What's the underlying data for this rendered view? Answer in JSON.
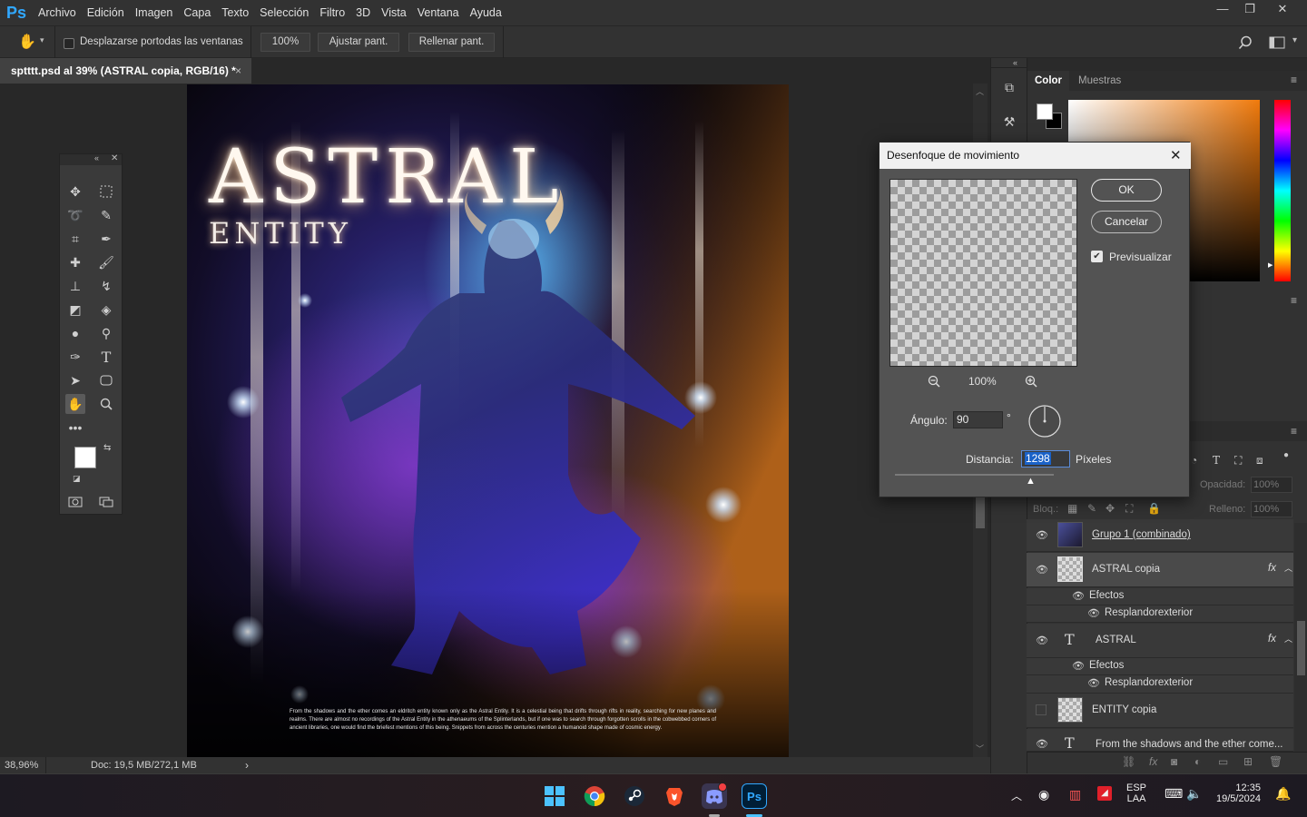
{
  "app": {
    "logo": "Ps",
    "menu": [
      "Archivo",
      "Edición",
      "Imagen",
      "Capa",
      "Texto",
      "Selección",
      "Filtro",
      "3D",
      "Vista",
      "Ventana",
      "Ayuda"
    ],
    "window_controls": {
      "minimize": "—",
      "restore": "❐",
      "close": "✕"
    }
  },
  "options": {
    "scroll_all_label": "Desplazarse portodas las ventanas",
    "zoom_100": "100%",
    "fit_screen": "Ajustar pant.",
    "fill_screen": "Rellenar pant."
  },
  "document": {
    "tab_title": "sptttt.psd al 39% (ASTRAL copia, RGB/16) *",
    "close": "×"
  },
  "artwork": {
    "title": "ASTRAL",
    "subtitle": "ENTITY",
    "body_text": "From the shadows and the ether comes an eldritch entity known only as the Astral Entity. It is a celestial being that drifts through rifts in reality, searching for new planes and realms. There are almost no recordings of the Astral Entity in the athenaeums of the Splinterlands, but if one was to search through forgotten scrolls in the cobwebbed corners of ancient libraries, one would find the briefest mentions of this being. Snippets from across the centuries mention a humanoid shape made of cosmic energy."
  },
  "status": {
    "zoom": "38,96%",
    "doc": "Doc: 19,5 MB/272,1 MB"
  },
  "color_panel": {
    "tabs": [
      "Color",
      "Muestras"
    ]
  },
  "dialog": {
    "title": "Desenfoque de movimiento",
    "ok": "OK",
    "cancel": "Cancelar",
    "preview_label": "Previsualizar",
    "preview_zoom": "100%",
    "angle_label": "Ángulo:",
    "angle_value": "90",
    "angle_unit": "°",
    "distance_label": "Distancia:",
    "distance_value": "1298",
    "distance_unit": "Píxeles"
  },
  "layers": {
    "lock_label": "Bloq.:",
    "opacity_label": "Opacidad:",
    "opacity_value": "100%",
    "fill_label": "Relleno:",
    "fill_value": "100%",
    "items": [
      {
        "name": "Grupo 1 (combinado)",
        "fx": ""
      },
      {
        "name": "ASTRAL copia",
        "fx": "fx"
      },
      {
        "name": "Efectos",
        "fx": ""
      },
      {
        "name": "Resplandorexterior",
        "fx": ""
      },
      {
        "name": "ASTRAL",
        "fx": "fx"
      },
      {
        "name": "Efectos",
        "fx": ""
      },
      {
        "name": "Resplandorexterior",
        "fx": ""
      },
      {
        "name": "ENTITY copia",
        "fx": ""
      },
      {
        "name": "From the shadows and the ether come...",
        "fx": ""
      }
    ]
  },
  "taskbar": {
    "lang_top": "ESP",
    "lang_bottom": "LAA",
    "time": "12:35",
    "date": "19/5/2024"
  }
}
